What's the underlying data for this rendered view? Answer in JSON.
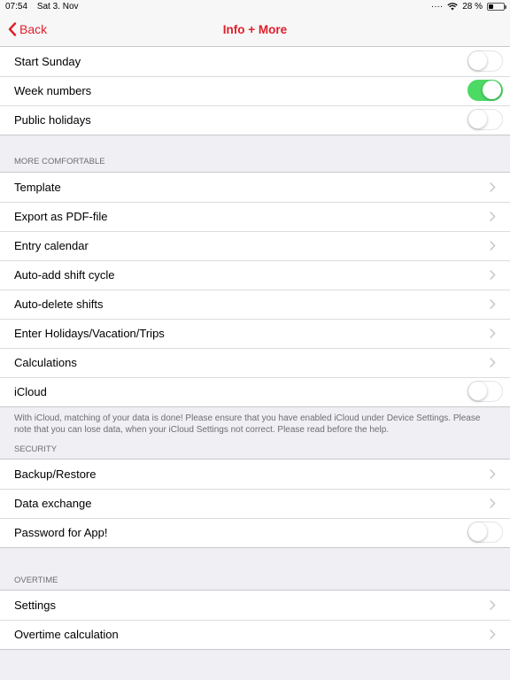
{
  "status": {
    "time": "07:54",
    "date": "Sat 3. Nov",
    "battery": "28 %",
    "battery_level": 0.28
  },
  "nav": {
    "back_label": "Back",
    "title": "Info + More"
  },
  "colors": {
    "accent": "#e01e2a",
    "toggle_on": "#4cd964",
    "background": "#efeff4"
  },
  "calendar_group": [
    {
      "label": "Start Sunday",
      "toggle": false
    },
    {
      "label": "Week numbers",
      "toggle": true
    },
    {
      "label": "Public holidays",
      "toggle": false
    }
  ],
  "more_comfortable": {
    "header": "MORE COMFORTABLE",
    "items": [
      {
        "label": "Template"
      },
      {
        "label": "Export as PDF-file"
      },
      {
        "label": "Entry calendar"
      },
      {
        "label": "Auto-add shift cycle"
      },
      {
        "label": "Auto-delete shifts"
      },
      {
        "label": "Enter Holidays/Vacation/Trips"
      },
      {
        "label": "Calculations"
      },
      {
        "label": "iCloud",
        "toggle": false
      }
    ],
    "footer": "With iCloud, matching of your data is done! Please ensure that you have enabled iCloud under Device Settings. Please note that you can lose data, when your iCloud Settings not correct. Please read before the help."
  },
  "security": {
    "header": "SECURITY",
    "items": [
      {
        "label": "Backup/Restore"
      },
      {
        "label": "Data exchange"
      },
      {
        "label": "Password for App!",
        "toggle": false
      }
    ]
  },
  "overtime": {
    "header": "OVERTIME",
    "items": [
      {
        "label": "Settings"
      },
      {
        "label": "Overtime calculation"
      }
    ]
  }
}
